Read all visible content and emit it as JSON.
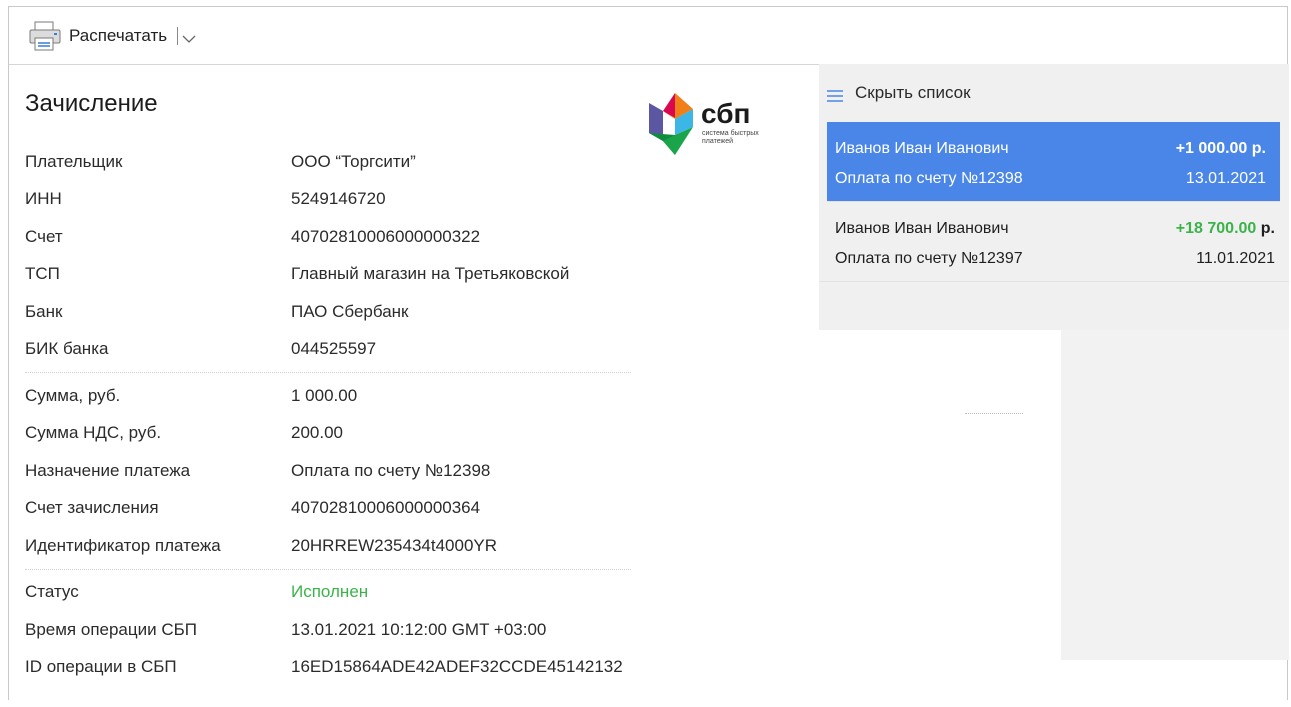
{
  "toolbar": {
    "print_label": "Распечатать",
    "print_icon": "printer-icon",
    "dropdown_icon": "chevron-down-icon"
  },
  "details": {
    "title": "Зачисление",
    "group1": [
      {
        "label": "Плательщик",
        "value": "ООО “Торгсити”"
      },
      {
        "label": "ИНН",
        "value": "5249146720"
      },
      {
        "label": "Счет",
        "value": "40702810006000000322"
      },
      {
        "label": "ТСП",
        "value": "Главный магазин на Третьяковской"
      },
      {
        "label": "Банк",
        "value": "ПАО Сбербанк"
      },
      {
        "label": "БИК банка",
        "value": "044525597"
      }
    ],
    "group2": [
      {
        "label": "Сумма, руб.",
        "value": "1 000.00"
      },
      {
        "label": "Сумма НДС, руб.",
        "value": "200.00"
      },
      {
        "label": "Назначение платежа",
        "value": "Оплата по счету №12398"
      },
      {
        "label": "Счет зачисления",
        "value": "40702810006000000364"
      },
      {
        "label": "Идентификатор платежа",
        "value": "20HRREW235434t4000YR"
      }
    ],
    "group3": [
      {
        "label": "Статус",
        "value": "Исполнен"
      },
      {
        "label": "Время операции СБП",
        "value": "13.01.2021 10:12:00 GMT +03:00"
      },
      {
        "label": "ID операции в СБП",
        "value": "16ED15864ADE42ADEF32CCDE45142132"
      }
    ]
  },
  "logo": {
    "name": "сбп",
    "tagline_1": "система быстрых",
    "tagline_2": "платежей"
  },
  "sidebar": {
    "hide_label": "Скрыть список",
    "hide_icon": "menu-icon",
    "items": [
      {
        "name": "Иванов Иван Иванович",
        "amount": "+1 000.00 р.",
        "purpose": "Оплата по счету №12398",
        "date": "13.01.2021",
        "selected": true
      },
      {
        "name": "Иванов Иван Иванович",
        "amount_value": "+18 700.00",
        "amount_unit": "р.",
        "purpose": "Оплата по счету №12397",
        "date": "11.01.2021",
        "selected": false
      }
    ]
  },
  "colors": {
    "selected_bg": "#4a86e8",
    "success": "#3cb34a",
    "sidebar_bg": "#f0f0f0"
  }
}
